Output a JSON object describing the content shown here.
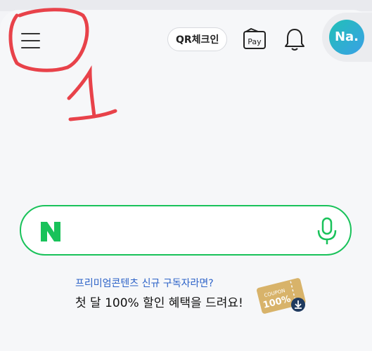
{
  "header": {
    "qr_checkin_label": "QR체크인",
    "pay_label": "Pay",
    "avatar_initials": "Na."
  },
  "annotation": {
    "number": "1",
    "color": "#e8424a"
  },
  "search": {
    "logo_letter": "N",
    "placeholder": "",
    "accent_color": "#19c25a"
  },
  "promo": {
    "subtitle": "프리미엄콘텐츠 신규 구독자라면?",
    "title": "첫 달 100% 할인 혜택을 드려요!",
    "coupon_word": "COUPON",
    "coupon_percent": "100%"
  }
}
